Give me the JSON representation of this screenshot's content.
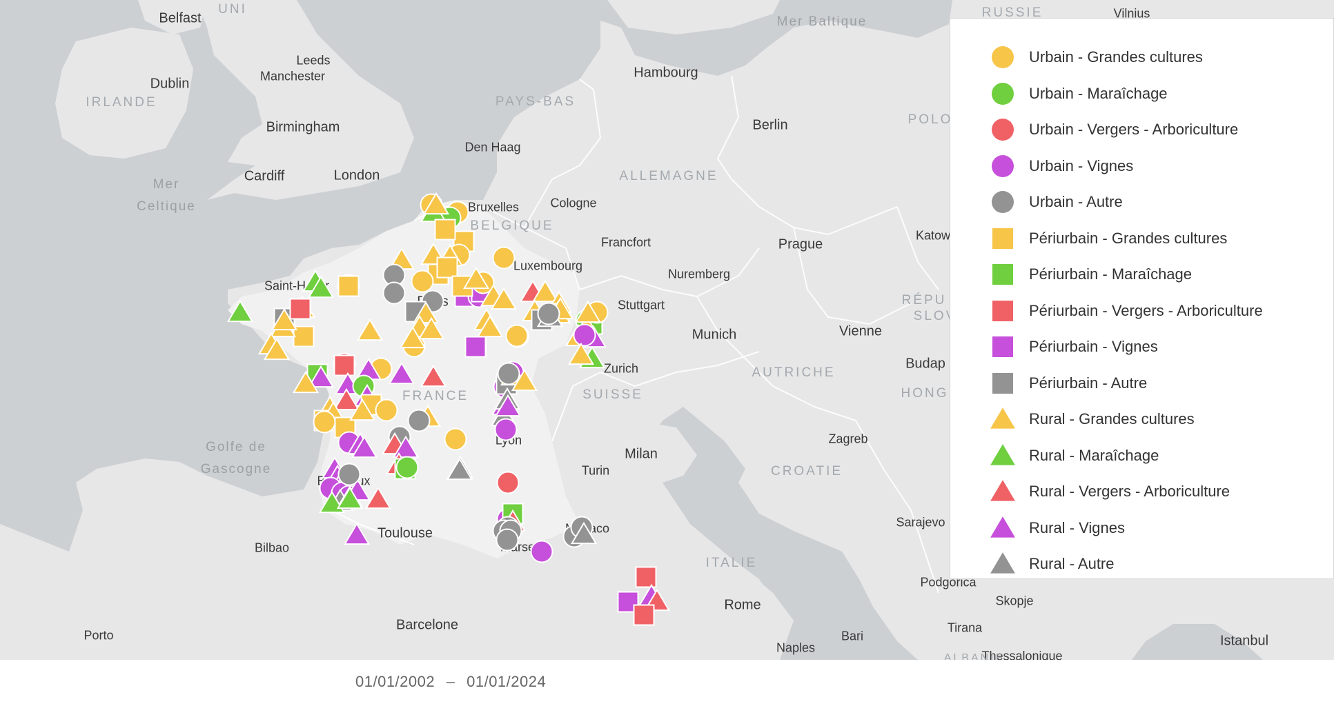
{
  "map": {
    "colors": {
      "water": "#cdd0d3",
      "land_other": "#e7e7e8",
      "land_focus": "#f1f1f1",
      "border": "#ffffff"
    },
    "cities": [
      "Belfast",
      "Dublin",
      "Leeds",
      "Manchester",
      "Birmingham",
      "Cardiff",
      "London",
      "Den Haag",
      "Hambourg",
      "Berlin",
      "Bruxelles",
      "Cologne",
      "Francfort",
      "Luxembourg",
      "Paris",
      "Saint-Hélier",
      "Prague",
      "Nuremberg",
      "Stuttgart",
      "Munich",
      "Vienne",
      "Zurich",
      "Lyon",
      "Bordeaux",
      "Toulouse",
      "Bilbao",
      "Marseille",
      "Monaco",
      "Milan",
      "Turin",
      "Zagreb",
      "Budap",
      "Katow",
      "Vilnius",
      "Sarajevo",
      "Podgorica",
      "Skopje",
      "Tirana",
      "Rome",
      "Bari",
      "Naples",
      "Barcelone",
      "Porto",
      "Istanbul",
      "Thessalonique"
    ],
    "countries": [
      "UNI",
      "IRLANDE",
      "PAYS-BAS",
      "ALLEMAGNE",
      "BELGIQUE",
      "FRANCE",
      "SUISSE",
      "AUTRICHE",
      "CROATIE",
      "ITALIE",
      "POLO",
      "RÉPU",
      "SLOV",
      "HONG",
      "RUSSIE",
      "ALBANIE"
    ],
    "seas": [
      "Mer Baltique",
      "Mer Celtique",
      "Golfe de Gascogne"
    ]
  },
  "legend": {
    "items": [
      {
        "label": "Urbain - Grandes cultures",
        "shape": "circle",
        "color": "#f7c548"
      },
      {
        "label": "Urbain - Maraîchage",
        "shape": "circle",
        "color": "#6fcf3e"
      },
      {
        "label": "Urbain - Vergers - Arboriculture",
        "shape": "circle",
        "color": "#f06166"
      },
      {
        "label": "Urbain - Vignes",
        "shape": "circle",
        "color": "#c64fdb"
      },
      {
        "label": "Urbain - Autre",
        "shape": "circle",
        "color": "#939393"
      },
      {
        "label": "Périurbain - Grandes cultures",
        "shape": "square",
        "color": "#f7c548"
      },
      {
        "label": "Périurbain - Maraîchage",
        "shape": "square",
        "color": "#6fcf3e"
      },
      {
        "label": "Périurbain - Vergers - Arboriculture",
        "shape": "square",
        "color": "#f06166"
      },
      {
        "label": "Périurbain - Vignes",
        "shape": "square",
        "color": "#c64fdb"
      },
      {
        "label": "Périurbain - Autre",
        "shape": "square",
        "color": "#939393"
      },
      {
        "label": "Rural - Grandes cultures",
        "shape": "triangle",
        "color": "#f7c548"
      },
      {
        "label": "Rural - Maraîchage",
        "shape": "triangle",
        "color": "#6fcf3e"
      },
      {
        "label": "Rural - Vergers - Arboriculture",
        "shape": "triangle",
        "color": "#f06166"
      },
      {
        "label": "Rural - Vignes",
        "shape": "triangle",
        "color": "#c64fdb"
      },
      {
        "label": "Rural - Autre",
        "shape": "triangle",
        "color": "#939393"
      }
    ]
  },
  "date_range": {
    "start": "01/01/2002",
    "separator": "–",
    "end": "01/01/2024"
  }
}
